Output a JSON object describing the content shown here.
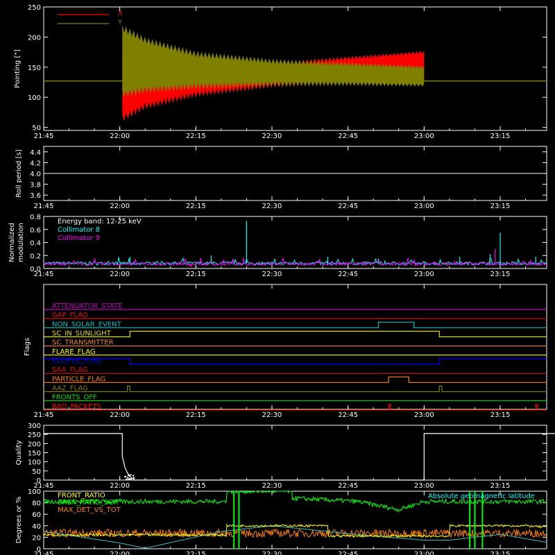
{
  "time_ticks": [
    "21:45",
    "22:00",
    "22:15",
    "22:30",
    "22:45",
    "23:00",
    "23:15"
  ],
  "chart_data": [
    {
      "type": "area",
      "panel": "pointing",
      "ylabel": "Pointing [\"]",
      "ylim": [
        45,
        250
      ],
      "yticks": [
        50,
        100,
        150,
        200,
        250
      ],
      "xlim": [
        "21:45",
        "23:35"
      ],
      "baseline": 127,
      "series": [
        {
          "name": "X",
          "color": "#ff0000",
          "x": [
            "22:00:30",
            "22:05",
            "22:15",
            "22:30",
            "22:45",
            "23:00"
          ],
          "low": [
            65,
            85,
            105,
            120,
            125,
            130
          ],
          "high": [
            165,
            150,
            148,
            155,
            165,
            175
          ]
        },
        {
          "name": "Y",
          "color": "#808000",
          "x": [
            "22:00:30",
            "22:05",
            "22:15",
            "22:30",
            "22:45",
            "23:00"
          ],
          "low": [
            105,
            112,
            118,
            122,
            122,
            120
          ],
          "high": [
            215,
            195,
            172,
            160,
            155,
            150
          ]
        }
      ]
    },
    {
      "type": "line",
      "panel": "roll",
      "ylabel": "Roll period [s]",
      "ylim": [
        3.5,
        4.5
      ],
      "yticks": [
        "3.6",
        "3.8",
        "4.0",
        "4.2",
        "4.4"
      ],
      "series": [
        {
          "color": "#ffffff",
          "x": [
            "21:45",
            "23:35"
          ],
          "y": [
            4.0,
            4.0
          ]
        }
      ]
    },
    {
      "type": "line",
      "panel": "modulation",
      "ylabel": "Normalized modulation",
      "ylim": [
        0,
        0.8
      ],
      "yticks": [
        "0.0",
        "0.2",
        "0.4",
        "0.6",
        "0.8"
      ],
      "annotation": "Energy band: 12-25 keV",
      "series": [
        {
          "name": "Collimator 8",
          "color": "#00ffff",
          "baseline": 0.08,
          "spikes": [
            [
              "22:02",
              0.18
            ],
            [
              "22:18",
              0.2
            ],
            [
              "22:25",
              0.73
            ],
            [
              "22:41",
              0.18
            ],
            [
              "22:51",
              0.15
            ],
            [
              "23:07",
              0.18
            ],
            [
              "23:13",
              0.22
            ],
            [
              "23:15",
              0.55
            ],
            [
              "23:22",
              0.18
            ]
          ]
        },
        {
          "name": "Collimator 9",
          "color": "#ff00ff",
          "baseline": 0.07,
          "spikes": [
            [
              "22:02",
              0.08
            ],
            [
              "22:14",
              0.02
            ],
            [
              "23:06",
              0.12
            ],
            [
              "23:14",
              0.3
            ],
            [
              "23:34",
              0.48
            ]
          ]
        }
      ]
    },
    {
      "type": "line",
      "panel": "flags",
      "ylabel": "Flags",
      "series": [
        {
          "name": "ATTENUATOR_STATE",
          "color": "#c000c0",
          "steps": []
        },
        {
          "name": "GAP_FLAG",
          "color": "#e01010",
          "steps": []
        },
        {
          "name": "NON_SOLAR_EVENT",
          "color": "#00c0c0",
          "steps": [
            [
              "22:51",
              "22:58"
            ]
          ]
        },
        {
          "name": "SC_IN_SUNLIGHT",
          "color": "#e0e000",
          "steps": [
            [
              "22:02",
              "23:03"
            ]
          ]
        },
        {
          "name": "SC_TRANSMITTER",
          "color": "#f08040",
          "steps": []
        },
        {
          "name": "FLARE_FLAG",
          "color": "#ffff00",
          "steps": []
        },
        {
          "name": "ECLIPSE_FLAG",
          "color": "#0000ff",
          "steps": [
            [
              "21:45",
              "22:02"
            ],
            [
              "23:03",
              "23:35"
            ]
          ]
        },
        {
          "name": "SAA_FLAG",
          "color": "#e01010",
          "steps": []
        },
        {
          "name": "PARTICLE_FLAG",
          "color": "#ff8000",
          "steps": [
            [
              "22:53",
              "22:57"
            ]
          ]
        },
        {
          "name": "AAZ_FLAG",
          "color": "#808000",
          "steps": [
            [
              "22:01:30",
              "22:02"
            ],
            [
              "23:03",
              "23:03:30"
            ]
          ]
        },
        {
          "name": "FRONTS_OFF",
          "color": "#00e000",
          "steps": []
        },
        {
          "name": "BAD_PACKETS",
          "color": "#ff0000",
          "steps": [
            [
              "22:53",
              "22:53:20"
            ],
            [
              "23:22",
              "23:22:20"
            ]
          ]
        }
      ]
    },
    {
      "type": "line",
      "panel": "quality",
      "ylabel": "Quality",
      "ylim": [
        0,
        300
      ],
      "yticks": [
        "0",
        "50",
        "100",
        "150",
        "200",
        "250",
        "300"
      ],
      "series": [
        {
          "color": "#ffffff",
          "x": [
            "21:45",
            "22:00:30",
            "22:00:30",
            "22:01",
            "22:01:30",
            "22:02",
            "22:02:30",
            "22:03",
            "23:00",
            "23:00",
            "23:35"
          ],
          "y": [
            255,
            255,
            130,
            70,
            40,
            20,
            10,
            0,
            0,
            255,
            255
          ]
        }
      ]
    },
    {
      "type": "line",
      "panel": "lower",
      "ylabel": "Degrees or %",
      "ylim": [
        0,
        100
      ],
      "yticks": [
        "0",
        "20",
        "40",
        "60",
        "80",
        "100"
      ],
      "annotation": "Absolute geomagnetic latitude",
      "series": [
        {
          "name": "FRONT_RATIO",
          "color": "#00ff00",
          "base": 82,
          "x": [
            "21:45",
            "22:21",
            "22:21",
            "22:34",
            "22:34",
            "22:47",
            "22:55",
            "23:00",
            "23:35"
          ],
          "y": [
            82,
            82,
            100,
            100,
            88,
            82,
            68,
            82,
            82
          ]
        },
        {
          "name": "MAX_DET_VS_TOT",
          "color": "#ff8000",
          "base": 27,
          "x": [
            "21:45",
            "22:21",
            "22:34",
            "23:00",
            "23:35"
          ],
          "y": [
            27,
            27,
            27,
            27,
            27
          ]
        },
        {
          "name": "Absolute geomagnetic latitude",
          "color": "#40c0c0",
          "x": [
            "21:45",
            "22:00",
            "22:05",
            "22:20",
            "22:30",
            "22:50",
            "23:00",
            "23:05",
            "23:15",
            "23:25",
            "23:35"
          ],
          "y": [
            30,
            10,
            1,
            30,
            40,
            22,
            15,
            15,
            25,
            10,
            0
          ]
        },
        {
          "name": "",
          "color": "#ffff00",
          "x": [
            "21:45",
            "22:21",
            "22:21",
            "22:30",
            "22:41",
            "22:41",
            "23:05",
            "23:05",
            "23:15",
            "23:20",
            "23:35"
          ],
          "y": [
            24,
            24,
            40,
            40,
            40,
            22,
            22,
            40,
            40,
            40,
            30
          ]
        }
      ],
      "vlines": [
        {
          "t": "22:22:30",
          "color": "#00ff00"
        },
        {
          "t": "22:23:30",
          "color": "#00ff00"
        },
        {
          "t": "23:09",
          "color": "#00ff00"
        },
        {
          "t": "23:10",
          "color": "#00ff00"
        },
        {
          "t": "23:11:30",
          "color": "#00ff00"
        }
      ]
    }
  ],
  "legend_labels": {
    "front_ratio": "FRONT_RATIO",
    "max_det": "MAX_DET_VS_TOT",
    "partial": "BACK_RATIO_SCR"
  },
  "pointing_legend": {
    "x": "X",
    "y": "Y"
  }
}
